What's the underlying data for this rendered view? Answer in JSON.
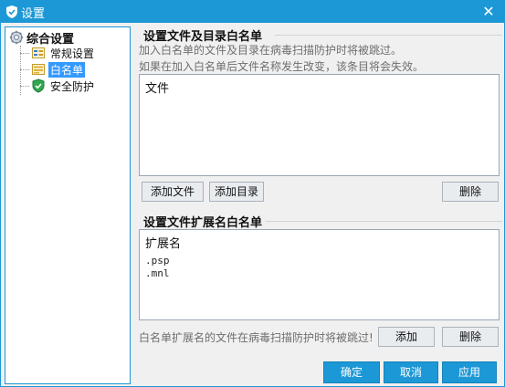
{
  "window": {
    "title": "设置",
    "close_icon": "close-icon"
  },
  "tree": {
    "root": {
      "label": "综合设置",
      "icon": "gear-icon"
    },
    "items": [
      {
        "label": "常规设置",
        "icon": "settings-panel-icon",
        "selected": false
      },
      {
        "label": "白名单",
        "icon": "list-icon",
        "selected": true
      },
      {
        "label": "安全防护",
        "icon": "shield-icon",
        "selected": false
      }
    ]
  },
  "dir_whitelist": {
    "title": "设置文件及目录白名单",
    "desc_line1": "加入白名单的文件及目录在病毒扫描防护时将被跳过。",
    "desc_line2": "如果在加入白名单后文件名称发生改变，该条目将会失效。",
    "list_header": "文件",
    "add_file_label": "添加文件",
    "add_dir_label": "添加目录",
    "delete_label": "删除"
  },
  "ext_whitelist": {
    "title": "设置文件扩展名白名单",
    "list_header": "扩展名",
    "items": [
      ".psp",
      ".mnl"
    ],
    "hint": "白名单扩展名的文件在病毒扫描防护时将被跳过!",
    "add_label": "添加",
    "delete_label": "删除"
  },
  "footer": {
    "ok_label": "确定",
    "cancel_label": "取消",
    "apply_label": "应用"
  },
  "colors": {
    "accent": "#1d98d6",
    "selection": "#3399ff"
  }
}
